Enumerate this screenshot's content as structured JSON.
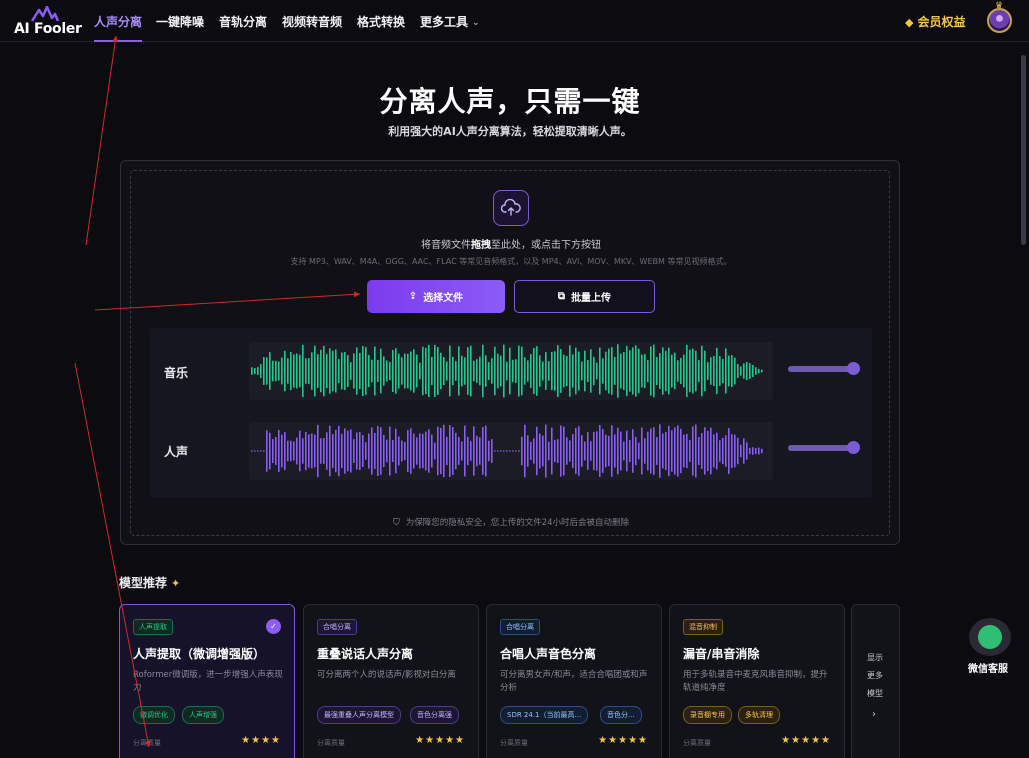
{
  "nav": {
    "logo_text": "AI Fooler",
    "links": [
      {
        "label": "人声分离",
        "active": true
      },
      {
        "label": "一键降噪"
      },
      {
        "label": "音轨分离"
      },
      {
        "label": "视频转音频"
      },
      {
        "label": "格式转换"
      },
      {
        "label": "更多工具"
      }
    ],
    "vip_label": "会员权益"
  },
  "hero": {
    "title": "分离人声，只需一键",
    "subtitle": "利用强大的AI人声分离算法，轻松提取清晰人声。"
  },
  "upload": {
    "hint_prefix": "将音频文件",
    "hint_bold": "拖拽",
    "hint_suffix": "至此处，或点击下方按钮",
    "formats": "支持 MP3、WAV、M4A、OGG、AAC、FLAC 等常见音频格式，以及 MP4、AVI、MOV、MKV、WEBM 等常见视频格式。",
    "select_button": "选择文件",
    "batch_button": "批量上传",
    "tracks": [
      {
        "label": "音乐",
        "color": "#22c98a",
        "volume": 1.0
      },
      {
        "label": "人声",
        "color": "#8b5cf6",
        "volume": 1.0
      }
    ],
    "privacy": "为保障您的隐私安全，您上传的文件24小时后会被自动删除"
  },
  "models": {
    "title": "模型推荐",
    "cards": [
      {
        "tag": "人声提取",
        "tag_color": "#22c98a",
        "selected": true,
        "title": "人声提取（微调增强版）",
        "desc": "Roformer微调版，进一步增强人声表现力",
        "chips": [
          "微调优化",
          "人声增强"
        ],
        "chip_color": "#22c98a",
        "quality_label": "分离质量",
        "stars": "★★★★"
      },
      {
        "tag": "合唱分离",
        "tag_color": "#a78bfa",
        "selected": false,
        "title": "重叠说话人声分离",
        "desc": "可分离两个人的说话声/影视对白分离",
        "chips": [
          "最强重叠人声分离模型",
          "音色分离强"
        ],
        "chip_color": "#a78bfa",
        "quality_label": "分离质量",
        "stars": "★★★★★"
      },
      {
        "tag": "合唱分离",
        "tag_color": "#60a5fa",
        "selected": false,
        "title": "合唱人声音色分离",
        "desc": "可分离男女声/和声，适合合唱团或和声分析",
        "chips": [
          "SDR 24.1（当前最高...",
          "音色分..."
        ],
        "chip_color": "#60a5fa",
        "quality_label": "分离质量",
        "stars": "★★★★★"
      },
      {
        "tag": "混音抑制",
        "tag_color": "#f5c542",
        "selected": false,
        "title": "漏音/串音消除",
        "desc": "用于多轨录音中麦克风串音抑制，提升轨道纯净度",
        "chips": [
          "录音棚专用",
          "多轨清理"
        ],
        "chip_color": "#f5c542",
        "quality_label": "分离质量",
        "stars": "★★★★★"
      }
    ],
    "more_label": "显示更多模型",
    "more_arrow": "›"
  },
  "support": {
    "label": "微信客服"
  }
}
